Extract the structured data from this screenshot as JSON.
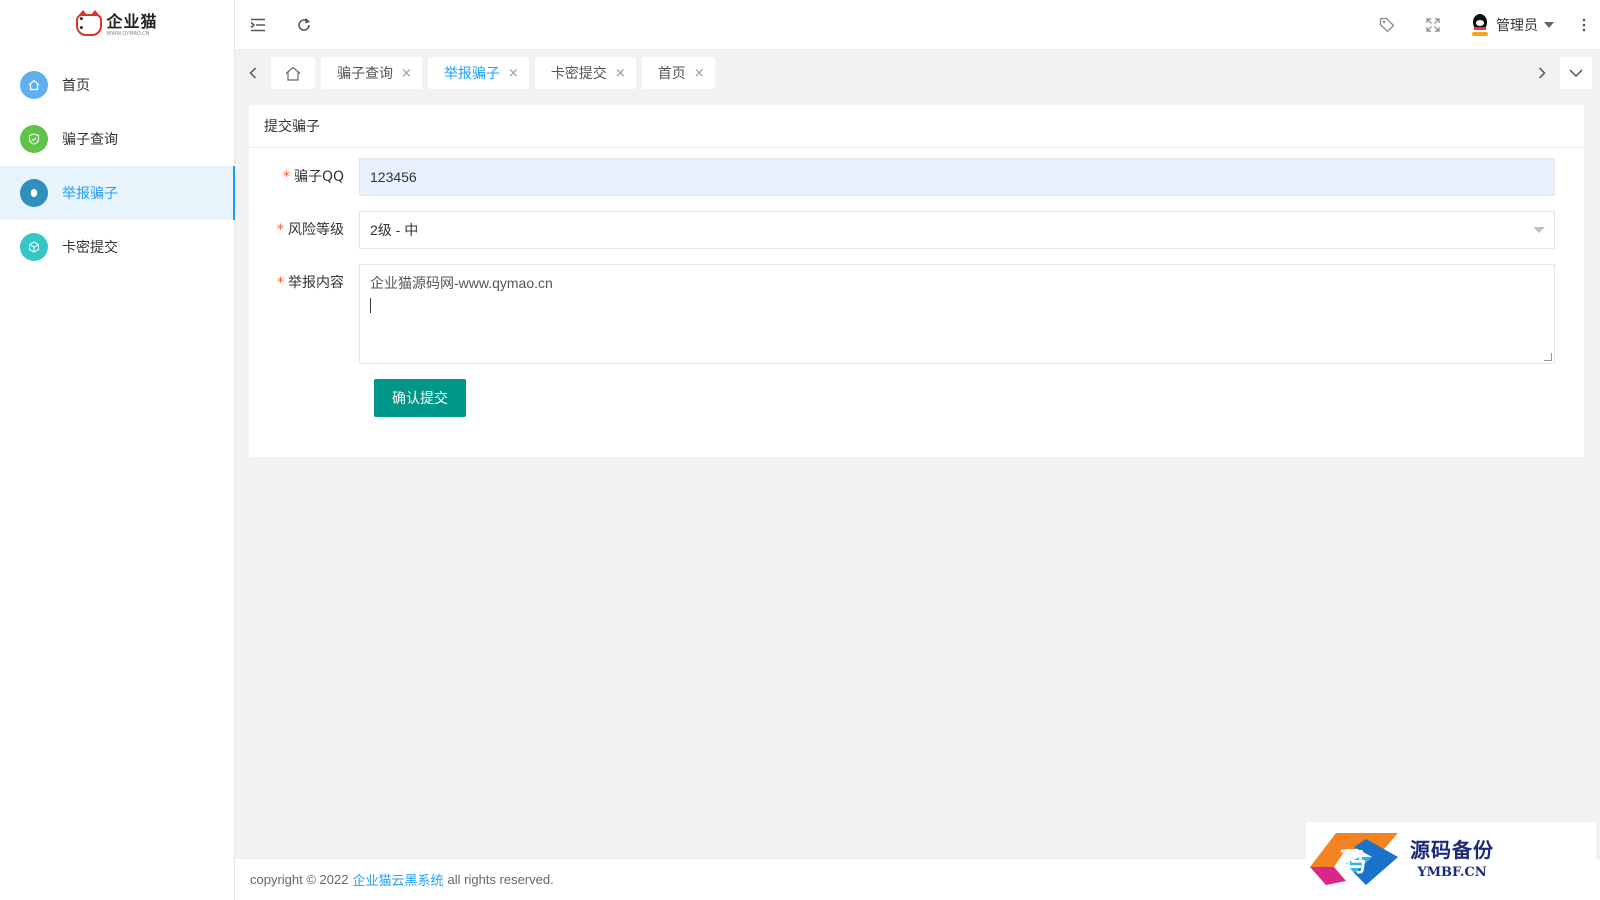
{
  "logo": {
    "text": "企业猫",
    "sub": "WWW.QYMAO.CN"
  },
  "sidebar": {
    "items": [
      {
        "label": "首页",
        "color": "#5fb0ef",
        "icon": "home-icon"
      },
      {
        "label": "骗子查询",
        "color": "#5fc24a",
        "icon": "shield-check-icon"
      },
      {
        "label": "举报骗子",
        "color": "#2f8fbd",
        "icon": "user-report-icon",
        "active": true
      },
      {
        "label": "卡密提交",
        "color": "#36c6c8",
        "icon": "cube-icon"
      }
    ]
  },
  "header": {
    "menu_toggle_icon": "menu-fold-icon",
    "refresh_icon": "refresh-icon",
    "tag_icon": "tag-icon",
    "fullscreen_icon": "fullscreen-icon",
    "user_name": "管理员",
    "more_icon": "more-vertical-icon"
  },
  "tabs": {
    "items": [
      {
        "label": "骗子查询"
      },
      {
        "label": "举报骗子",
        "active": true
      },
      {
        "label": "卡密提交"
      },
      {
        "label": "首页"
      }
    ],
    "close_glyph": "×"
  },
  "form": {
    "title": "提交骗子",
    "qq_label": "骗子QQ",
    "qq_value": "123456",
    "risk_label": "风险等级",
    "risk_value": "2级 - 中",
    "content_label": "举报内容",
    "content_value": "企业猫源码网-www.qymao.cn",
    "submit_label": "确认提交"
  },
  "footer": {
    "prefix": "copyright © 2022",
    "link": "企业猫云黑系统",
    "suffix": "all rights reserved."
  },
  "watermark": {
    "glyph": "码",
    "title": "源码备份",
    "url": "YMBF.CN"
  },
  "colors": {
    "accent": "#1e9fff",
    "button": "#009688",
    "required": "#ff5722"
  }
}
